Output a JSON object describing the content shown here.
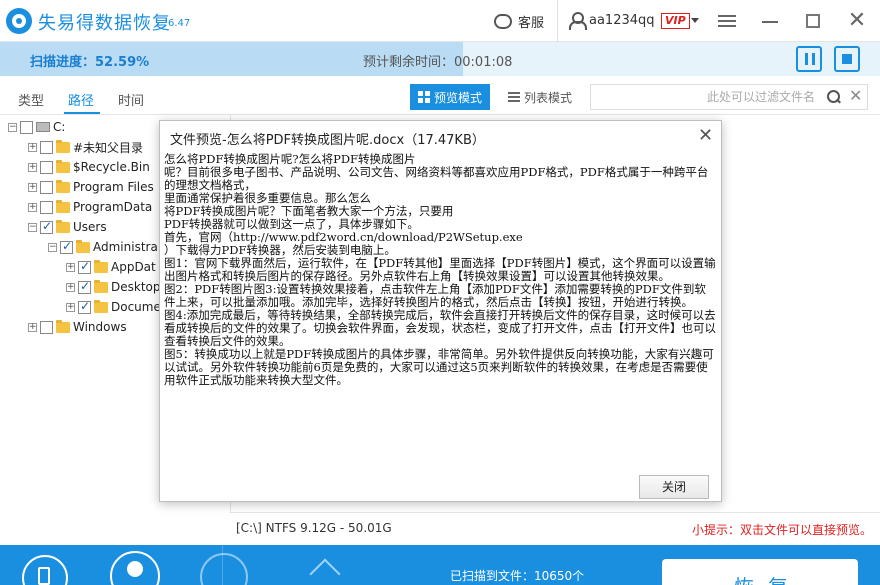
{
  "app": {
    "title": "失易得数据恢复",
    "version": "6.47",
    "service_label": "客服",
    "username": "aa1234qq",
    "vip_label": "VIP"
  },
  "progress": {
    "label": "扫描进度：52.59%",
    "fraction": 0.5259,
    "remaining_label": "预计剩余时间：00:01:08"
  },
  "tabs": [
    "类型",
    "路径",
    "时间"
  ],
  "active_tab": "路径",
  "view_modes": {
    "preview": "预览模式",
    "list": "列表模式"
  },
  "filter": {
    "placeholder": "此处可以过滤文件名"
  },
  "tree": [
    {
      "label": "C:",
      "level": 0,
      "expander": "−",
      "checked": false,
      "icon": "drive-icon"
    },
    {
      "label": "#未知父目录",
      "level": 1,
      "expander": "+",
      "checked": false,
      "icon": "folder-icon"
    },
    {
      "label": "$Recycle.Bin",
      "level": 1,
      "expander": "+",
      "checked": false,
      "icon": "folder-icon"
    },
    {
      "label": "Program Files",
      "level": 1,
      "expander": "+",
      "checked": false,
      "icon": "folder-icon"
    },
    {
      "label": "ProgramData",
      "level": 1,
      "expander": "+",
      "checked": false,
      "icon": "folder-icon"
    },
    {
      "label": "Users",
      "level": 1,
      "expander": "−",
      "checked": true,
      "icon": "folder-icon"
    },
    {
      "label": "Administra",
      "level": 2,
      "expander": "−",
      "checked": true,
      "icon": "folder-icon"
    },
    {
      "label": "AppDat",
      "level": 3,
      "expander": "+",
      "checked": true,
      "icon": "folder-icon"
    },
    {
      "label": "Desktop",
      "level": 3,
      "expander": "+",
      "checked": true,
      "icon": "folder-icon"
    },
    {
      "label": "Docume",
      "level": 3,
      "expander": "+",
      "checked": true,
      "icon": "folder-icon"
    },
    {
      "label": "Windows",
      "level": 1,
      "expander": "+",
      "checked": false,
      "icon": "folder-icon"
    }
  ],
  "status": {
    "disk_info": "[C:\\] NTFS 9.12G - 50.01G",
    "tip": "小提示：双击文件可以直接预览。"
  },
  "bottom": {
    "scanned_label": "已扫描到文件：10650个",
    "recover_label": "恢复"
  },
  "dialog": {
    "title": "文件预览-怎么将PDF转换成图片呢.docx（17.47KB）",
    "close_label": "关闭",
    "lines": [
      "怎么将PDF转换成图片呢?怎么将PDF转换成图片",
      "呢？目前很多电子图书、产品说明、公司文告、网络资料等都喜欢应用PDF格式，PDF格式属于一种跨平台的理想文档格式，",
      "里面通常保护着很多重要信息。那么怎么",
      "将PDF转换成图片呢？下面笔者教大家一个方法，只要用",
      "PDF转换器就可以做到这一点了，具体步骤如下。",
      "首先，官网（http://www.pdf2word.cn/download/P2WSetup.exe",
      "）下载得力PDF转换器，然后安装到电脑上。",
      "图1：官网下载界面然后，运行软件，在【PDF转其他】里面选择【PDF转图片】模式，这个界面可以设置输出图片格式和转换后图片的保存路径。另外点软件右上角【转换效果设置】可以设置其他转换效果。",
      "图2：PDF转图片图3:设置转换效果接着，点击软件左上角【添加PDF文件】添加需要转换的PDF文件到软件上来，可以批量添加哦。添加完毕，选择好转换图片的格式，然后点击【转换】按钮，开始进行转换。",
      "图4:添加完成最后，等待转换结果，全部转换完成后，软件会直接打开转换后文件的保存目录，这时候可以去看成转换后的文件的效果了。切换会软件界面，会发现，状态栏，变成了打开文件，点击【打开文件】也可以查看转换后文件的效果。",
      "图5：转换成功以上就是PDF转换成图片的具体步骤，非常简单。另外软件提供反向转换功能，大家有兴趣可以试试。另外软件转换功能前6页是免费的，大家可以通过这5页来判断软件的转换效果，在考虑是否需要使用软件正式版功能来转换大型文件。"
    ]
  },
  "colors": {
    "accent": "#1a8fe0",
    "tip": "#e02020"
  }
}
